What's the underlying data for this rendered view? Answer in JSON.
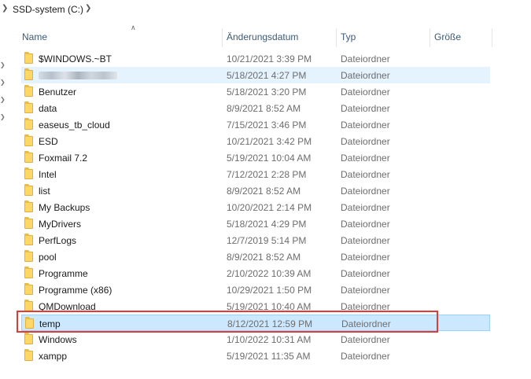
{
  "breadcrumb": {
    "path": "SSD-system (C:)"
  },
  "columns": {
    "name": "Name",
    "date": "Änderungsdatum",
    "type": "Typ",
    "size": "Größe"
  },
  "files": [
    {
      "name": "$WINDOWS.~BT",
      "date": "10/21/2021 3:39 PM",
      "type": "Dateiordner"
    },
    {
      "name": "",
      "date": "5/18/2021 4:27 PM",
      "type": "Dateiordner",
      "obscured": true
    },
    {
      "name": "Benutzer",
      "date": "5/18/2021 3:20 PM",
      "type": "Dateiordner"
    },
    {
      "name": "data",
      "date": "8/9/2021 8:52 AM",
      "type": "Dateiordner"
    },
    {
      "name": "easeus_tb_cloud",
      "date": "7/15/2021 3:46 PM",
      "type": "Dateiordner"
    },
    {
      "name": "ESD",
      "date": "10/21/2021 3:42 PM",
      "type": "Dateiordner"
    },
    {
      "name": "Foxmail 7.2",
      "date": "5/19/2021 10:04 AM",
      "type": "Dateiordner"
    },
    {
      "name": "Intel",
      "date": "7/12/2021 2:28 PM",
      "type": "Dateiordner"
    },
    {
      "name": "list",
      "date": "8/9/2021 8:52 AM",
      "type": "Dateiordner"
    },
    {
      "name": "My Backups",
      "date": "10/20/2021 2:14 PM",
      "type": "Dateiordner"
    },
    {
      "name": "MyDrivers",
      "date": "5/18/2021 4:29 PM",
      "type": "Dateiordner"
    },
    {
      "name": "PerfLogs",
      "date": "12/7/2019 5:14 PM",
      "type": "Dateiordner"
    },
    {
      "name": "pool",
      "date": "8/9/2021 8:52 AM",
      "type": "Dateiordner"
    },
    {
      "name": "Programme",
      "date": "2/10/2022 10:39 AM",
      "type": "Dateiordner"
    },
    {
      "name": "Programme (x86)",
      "date": "10/29/2021 1:50 PM",
      "type": "Dateiordner"
    },
    {
      "name": "QMDownload",
      "date": "5/19/2021 10:40 AM",
      "type": "Dateiordner"
    },
    {
      "name": "temp",
      "date": "8/12/2021 12:59 PM",
      "type": "Dateiordner",
      "selected": true
    },
    {
      "name": "Windows",
      "date": "1/10/2022 10:31 AM",
      "type": "Dateiordner"
    },
    {
      "name": "xampp",
      "date": "5/19/2021 11:35 AM",
      "type": "Dateiordner"
    }
  ],
  "icons": {
    "folder": "folder-icon",
    "chevron": "chevron-right-icon",
    "sort": "sort-ascending-icon"
  },
  "colors": {
    "selection": "#cce8ff",
    "hover": "#e5f3ff",
    "folder": "#ffd767",
    "highlight": "#e53935"
  }
}
